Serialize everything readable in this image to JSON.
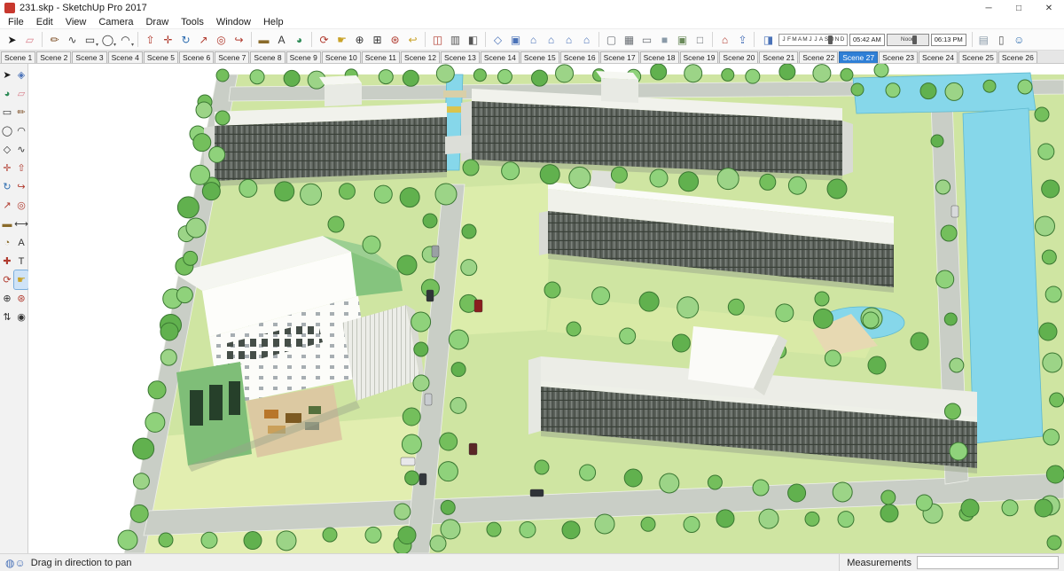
{
  "window": {
    "title": "231.skp - SketchUp Pro 2017",
    "minimize_glyph": "─",
    "maximize_glyph": "□",
    "close_glyph": "✕"
  },
  "menu": {
    "items": [
      "File",
      "Edit",
      "View",
      "Camera",
      "Draw",
      "Tools",
      "Window",
      "Help"
    ]
  },
  "toolbar": {
    "groups": [
      {
        "icons": [
          {
            "name": "select-tool",
            "glyph": "➤",
            "color": "#1b1b1b"
          },
          {
            "name": "eraser-tool",
            "glyph": "▱",
            "color": "#d9808c"
          }
        ]
      },
      {
        "icons": [
          {
            "name": "line-tool",
            "glyph": "✏",
            "color": "#7a4a20"
          },
          {
            "name": "freehand-tool",
            "glyph": "∿",
            "color": "#444444"
          },
          {
            "name": "rectangle-tool",
            "glyph": "▭",
            "color": "#333333",
            "dropdown": true
          },
          {
            "name": "circle-tool",
            "glyph": "◯",
            "color": "#333333",
            "dropdown": true
          },
          {
            "name": "arc-tool",
            "glyph": "◠",
            "color": "#333333",
            "dropdown": true
          }
        ]
      },
      {
        "icons": [
          {
            "name": "push-pull-tool",
            "glyph": "⇧",
            "color": "#b03a2e"
          },
          {
            "name": "move-tool",
            "glyph": "✛",
            "color": "#b03a2e"
          },
          {
            "name": "rotate-tool",
            "glyph": "↻",
            "color": "#2e6db0"
          },
          {
            "name": "scale-tool",
            "glyph": "↗",
            "color": "#b03a2e"
          },
          {
            "name": "offset-tool",
            "glyph": "◎",
            "color": "#b03a2e"
          },
          {
            "name": "follow-me-tool",
            "glyph": "↪",
            "color": "#b03a2e"
          }
        ]
      },
      {
        "icons": [
          {
            "name": "tape-measure-tool",
            "glyph": "▬",
            "color": "#8a6b2a"
          },
          {
            "name": "text-tool",
            "glyph": "A",
            "color": "#333333"
          },
          {
            "name": "paint-bucket-tool",
            "glyph": "◕",
            "color": "#2e8b57"
          }
        ]
      },
      {
        "icons": [
          {
            "name": "orbit-tool",
            "glyph": "⟳",
            "color": "#b03a2e"
          },
          {
            "name": "pan-tool",
            "glyph": "☛",
            "color": "#c9a227"
          },
          {
            "name": "zoom-tool",
            "glyph": "⊕",
            "color": "#333333"
          },
          {
            "name": "zoom-window-tool",
            "glyph": "⊞",
            "color": "#333333"
          },
          {
            "name": "zoom-extents-tool",
            "glyph": "⊛",
            "color": "#b03a2e"
          },
          {
            "name": "previous-view-icon",
            "glyph": "↩",
            "color": "#c9a227"
          }
        ]
      },
      {
        "icons": [
          {
            "name": "section-plane-icon",
            "glyph": "◫",
            "color": "#b03a2e"
          },
          {
            "name": "display-section-planes-icon",
            "glyph": "▥",
            "color": "#555555"
          },
          {
            "name": "display-section-cuts-icon",
            "glyph": "◧",
            "color": "#555555"
          }
        ]
      },
      {
        "icons": [
          {
            "name": "iso-view-icon",
            "glyph": "◇",
            "color": "#4a72b8"
          },
          {
            "name": "top-view-icon",
            "glyph": "▣",
            "color": "#4a72b8"
          },
          {
            "name": "front-view-icon",
            "glyph": "⌂",
            "color": "#4a72b8"
          },
          {
            "name": "right-view-icon",
            "glyph": "⌂",
            "color": "#4a72b8"
          },
          {
            "name": "back-view-icon",
            "glyph": "⌂",
            "color": "#4a72b8"
          },
          {
            "name": "left-view-icon",
            "glyph": "⌂",
            "color": "#4a72b8"
          }
        ]
      },
      {
        "icons": [
          {
            "name": "x-ray-style-icon",
            "glyph": "▢",
            "color": "#6a6f74"
          },
          {
            "name": "wireframe-style-icon",
            "glyph": "▦",
            "color": "#6a6f74"
          },
          {
            "name": "hidden-line-style-icon",
            "glyph": "▭",
            "color": "#6a6f74"
          },
          {
            "name": "shaded-style-icon",
            "glyph": "■",
            "color": "#8a9aa8"
          },
          {
            "name": "shaded-textures-style-icon",
            "glyph": "▣",
            "color": "#6a8a5a"
          },
          {
            "name": "monochrome-style-icon",
            "glyph": "□",
            "color": "#6a6f74"
          }
        ]
      },
      {
        "icons": [
          {
            "name": "3d-warehouse-icon",
            "glyph": "⌂",
            "color": "#b03a2e"
          },
          {
            "name": "share-model-icon",
            "glyph": "⇪",
            "color": "#4a72b8"
          }
        ]
      }
    ],
    "shadow": {
      "dialog_glyph": "◨",
      "months": [
        "J",
        "F",
        "M",
        "A",
        "M",
        "J",
        "J",
        "A",
        "S",
        "O",
        "N",
        "D"
      ],
      "start_time": "05:42 AM",
      "noon_label": "Noon",
      "end_time": "06:13 PM"
    },
    "tail_icons": [
      {
        "name": "fog-icon",
        "glyph": "▤",
        "color": "#8a9aa8"
      },
      {
        "name": "send-to-layout-icon",
        "glyph": "▯",
        "color": "#555555"
      },
      {
        "name": "warehouse-user-icon",
        "glyph": "☺",
        "color": "#2e6db0"
      }
    ]
  },
  "scenes": {
    "active": "Scene 27",
    "tabs": [
      "Scene 1",
      "Scene 2",
      "Scene 3",
      "Scene 4",
      "Scene 5",
      "Scene 6",
      "Scene 7",
      "Scene 8",
      "Scene 9",
      "Scene 10",
      "Scene 11",
      "Scene 12",
      "Scene 13",
      "Scene 14",
      "Scene 15",
      "Scene 16",
      "Scene 17",
      "Scene 18",
      "Scene 19",
      "Scene 20",
      "Scene 21",
      "Scene 22",
      "Scene 27",
      "Scene 23",
      "Scene 24",
      "Scene 25",
      "Scene 26"
    ]
  },
  "left_toolbar": {
    "icons": [
      {
        "name": "select-tool",
        "glyph": "➤",
        "color": "#1b1b1b"
      },
      {
        "name": "make-component-icon",
        "glyph": "◈",
        "color": "#4a72b8"
      },
      {
        "name": "paint-bucket-tool",
        "glyph": "◕",
        "color": "#2e8b57"
      },
      {
        "name": "eraser-tool",
        "glyph": "▱",
        "color": "#d9808c"
      },
      {
        "name": "rectangle-tool",
        "glyph": "▭",
        "color": "#333333"
      },
      {
        "name": "line-tool",
        "glyph": "✏",
        "color": "#7a4a20"
      },
      {
        "name": "circle-tool",
        "glyph": "◯",
        "color": "#333333"
      },
      {
        "name": "arc-tool",
        "glyph": "◠",
        "color": "#333333"
      },
      {
        "name": "polygon-tool",
        "glyph": "◇",
        "color": "#333333"
      },
      {
        "name": "freehand-tool",
        "glyph": "∿",
        "color": "#333333"
      },
      {
        "name": "move-tool",
        "glyph": "✛",
        "color": "#b03a2e"
      },
      {
        "name": "push-pull-tool",
        "glyph": "⇧",
        "color": "#b03a2e"
      },
      {
        "name": "rotate-tool",
        "glyph": "↻",
        "color": "#2e6db0"
      },
      {
        "name": "follow-me-tool",
        "glyph": "↪",
        "color": "#b03a2e"
      },
      {
        "name": "scale-tool",
        "glyph": "↗",
        "color": "#b03a2e"
      },
      {
        "name": "offset-tool",
        "glyph": "◎",
        "color": "#b03a2e"
      },
      {
        "name": "tape-measure-tool",
        "glyph": "▬",
        "color": "#8a6b2a"
      },
      {
        "name": "dimension-tool",
        "glyph": "⟷",
        "color": "#333333"
      },
      {
        "name": "protractor-tool",
        "glyph": "◔",
        "color": "#8a6b2a"
      },
      {
        "name": "text-tool",
        "glyph": "A",
        "color": "#333333"
      },
      {
        "name": "axes-tool",
        "glyph": "✚",
        "color": "#b03a2e"
      },
      {
        "name": "3d-text-tool",
        "glyph": "T",
        "color": "#333333"
      },
      {
        "name": "orbit-tool",
        "glyph": "⟳",
        "color": "#b03a2e"
      },
      {
        "name": "pan-tool",
        "glyph": "☛",
        "color": "#c9a227",
        "active": true
      },
      {
        "name": "zoom-tool",
        "glyph": "⊕",
        "color": "#333333"
      },
      {
        "name": "zoom-extents-tool",
        "glyph": "⊛",
        "color": "#b03a2e"
      },
      {
        "name": "walk-tool",
        "glyph": "⇅",
        "color": "#333333"
      },
      {
        "name": "look-around-tool",
        "glyph": "◉",
        "color": "#333333"
      }
    ]
  },
  "statusbar": {
    "icons": [
      {
        "name": "geolocation-icon",
        "glyph": "◍",
        "color": "#4a72b8"
      },
      {
        "name": "claim-credit-icon",
        "glyph": "☺",
        "color": "#4a72b8"
      }
    ],
    "hint": "Drag in direction to pan",
    "measurements_label": "Measurements",
    "measurements_value": ""
  },
  "colors": {
    "active_tab_bg": "#2f7fd6",
    "grass": "#cfe5a2",
    "water": "#86d7ea",
    "road": "#c9cec6",
    "facade": "#5c625c",
    "roof": "#f2f3ee",
    "tree_fill": "#74bf5c",
    "tree_stroke": "#3a7732"
  }
}
